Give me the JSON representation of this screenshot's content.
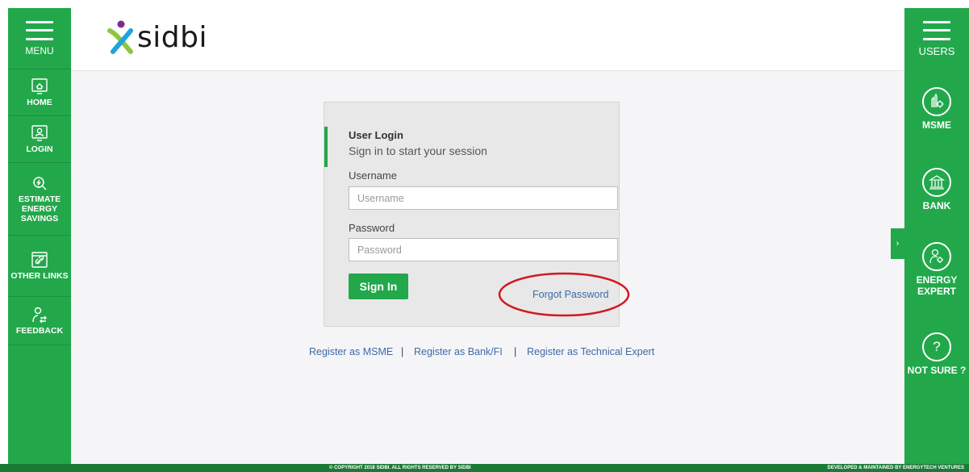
{
  "left_sidebar": {
    "menu_label": "MENU",
    "items": [
      {
        "label": "HOME",
        "icon": "home-monitor-icon"
      },
      {
        "label": "LOGIN",
        "icon": "login-user-icon"
      },
      {
        "label": "ESTIMATE ENERGY SAVINGS",
        "icon": "energy-estimate-icon"
      },
      {
        "label": "OTHER LINKS",
        "icon": "links-icon"
      },
      {
        "label": "FEEDBACK",
        "icon": "feedback-icon"
      }
    ]
  },
  "header": {
    "logo_text": "sidbi"
  },
  "login": {
    "title": "User Login",
    "subtitle": "Sign in to start your session",
    "username_label": "Username",
    "username_placeholder": "Username",
    "password_label": "Password",
    "password_placeholder": "Password",
    "signin_label": "Sign In",
    "forgot_label": "Forgot Password"
  },
  "register": {
    "msme": "Register as MSME",
    "bank": "Register as Bank/FI",
    "expert": "Register as Technical Expert",
    "separator": "|"
  },
  "toggle_tab": "›",
  "right_sidebar": {
    "users_label": "USERS",
    "roles": [
      {
        "label": "MSME",
        "icon": "msme-gear-icon"
      },
      {
        "label": "BANK",
        "icon": "bank-icon"
      },
      {
        "label": "ENERGY EXPERT",
        "icon": "expert-icon"
      },
      {
        "label": "NOT SURE ?",
        "icon": "question-icon",
        "glyph": "?"
      }
    ]
  },
  "footer": {
    "copyright": "© COPYRIGHT 2018 SIDBI. ALL RIGHTS RESERVED BY SIDBI",
    "developed": "DEVELOPED & MAINTAINED BY ENERGYTECH VENTURES"
  },
  "colors": {
    "brand_green": "#22a84b",
    "footer_green": "#1c7a37",
    "link_blue": "#3d6aa8",
    "annotation_red": "#d0191e"
  }
}
